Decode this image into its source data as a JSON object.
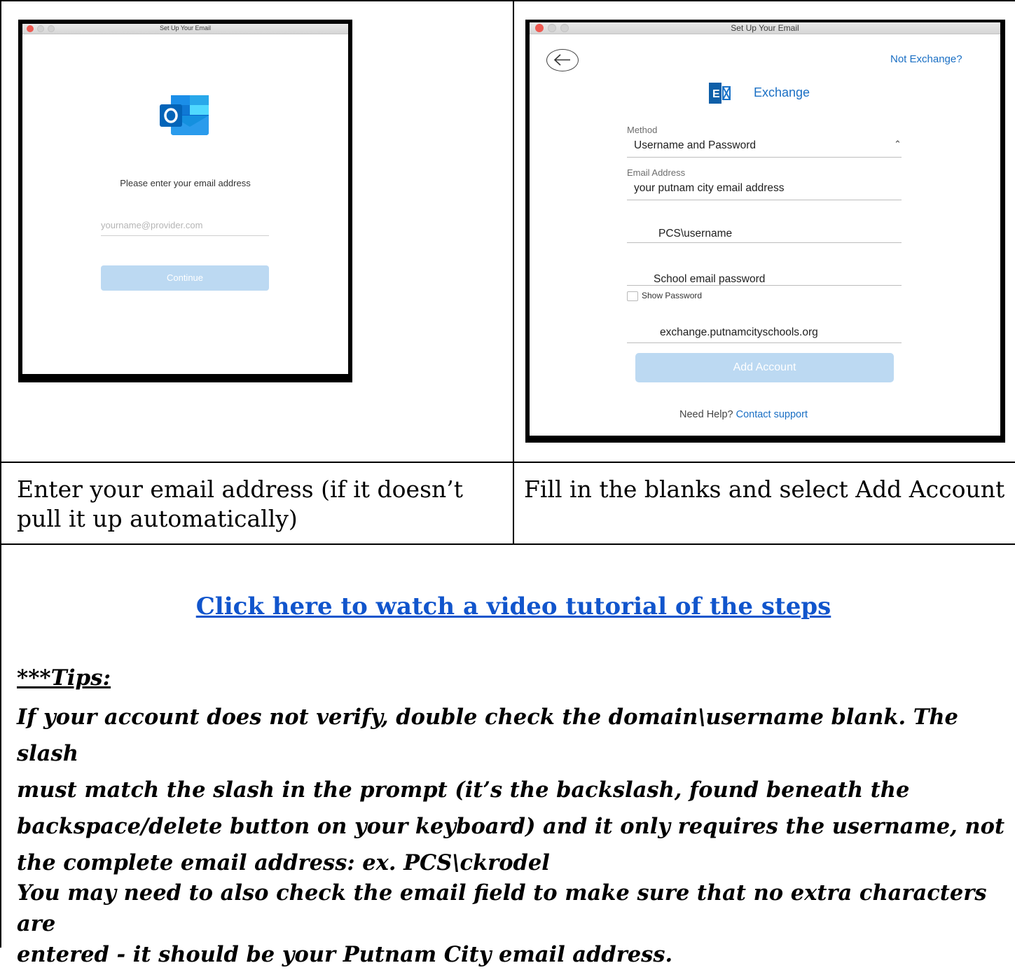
{
  "left_window": {
    "title": "Set Up Your Email",
    "prompt": "Please enter your email address",
    "email_placeholder": "yourname@provider.com",
    "continue_label": "Continue"
  },
  "right_window": {
    "title": "Set Up Your Email",
    "not_exchange": "Not Exchange?",
    "provider_label": "Exchange",
    "method_label": "Method",
    "method_value": "Username and Password",
    "email_label": "Email Address",
    "email_value": "your putnam city email address",
    "username_value": "PCS\\username",
    "password_value": "School email password",
    "show_password_label": "Show Password",
    "server_value": "exchange.putnamcityschools.org",
    "add_account_label": "Add Account",
    "help_text": "Need Help?",
    "contact_support": "Contact support"
  },
  "captions": {
    "left_line1": "Enter your email address (if it doesn’t",
    "left_line2": "pull it up automatically)",
    "right": "Fill in the blanks and select Add Account"
  },
  "bottom": {
    "video_link": "Click here to watch a video tutorial of the steps",
    "tips_heading": "***Tips:",
    "tips_lines": [
      "If your account does not verify, double check the domain\\username blank. The slash",
      "must match the slash in the prompt (it’s the backslash, found beneath the",
      "backspace/delete button on your keyboard) and it only requires the username, not",
      "the complete email address:  ex. PCS\\ckrodel"
    ],
    "tips2_lines": [
      "You may need to also check the email field to make sure that no extra characters are",
      "entered - it should be your Putnam City email address."
    ]
  },
  "colors": {
    "accent_blue": "#1a6fc4",
    "button_disabled": "#bcd9f2",
    "link_blue": "#1155cc"
  }
}
